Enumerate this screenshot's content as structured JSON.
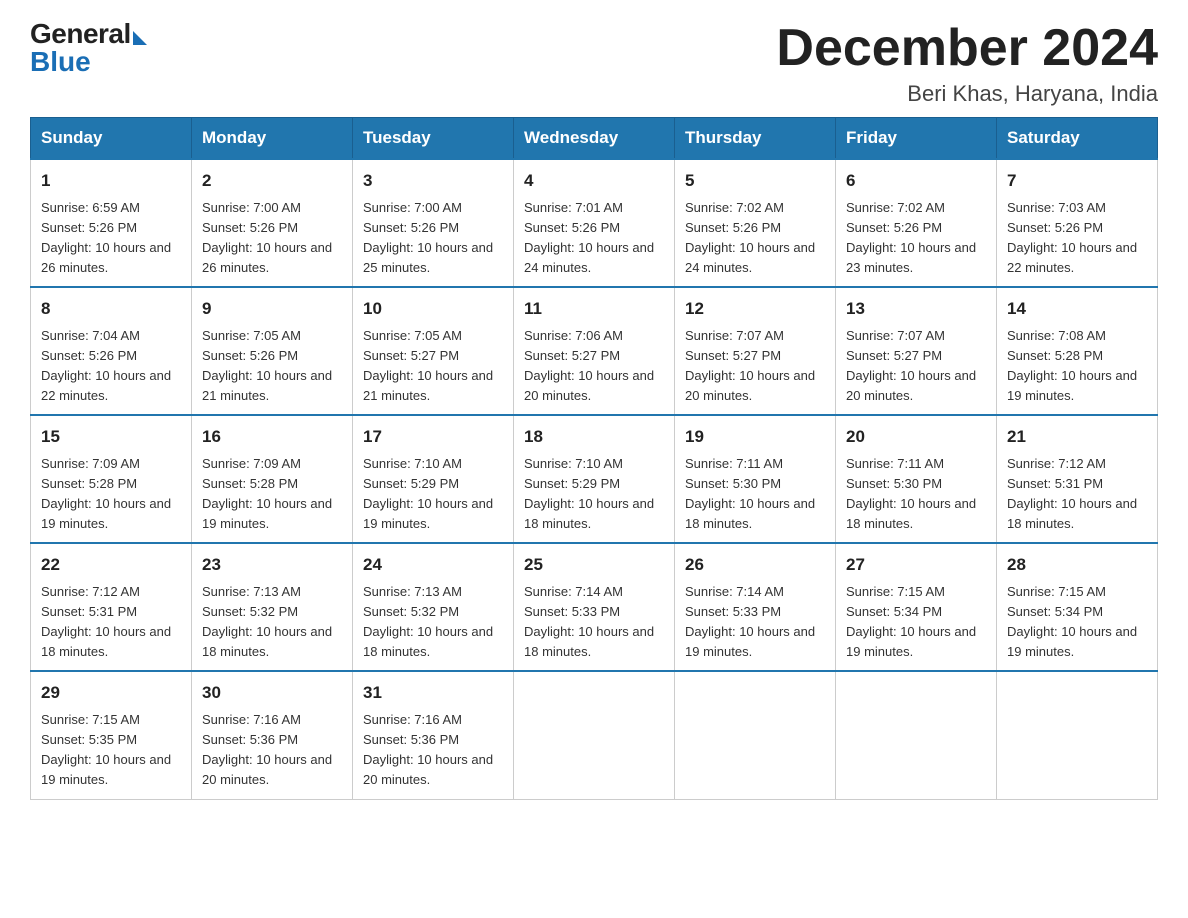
{
  "header": {
    "logo_general": "General",
    "logo_blue": "Blue",
    "main_title": "December 2024",
    "subtitle": "Beri Khas, Haryana, India"
  },
  "days_of_week": [
    "Sunday",
    "Monday",
    "Tuesday",
    "Wednesday",
    "Thursday",
    "Friday",
    "Saturday"
  ],
  "weeks": [
    [
      {
        "day": "1",
        "sunrise": "6:59 AM",
        "sunset": "5:26 PM",
        "daylight": "10 hours and 26 minutes."
      },
      {
        "day": "2",
        "sunrise": "7:00 AM",
        "sunset": "5:26 PM",
        "daylight": "10 hours and 26 minutes."
      },
      {
        "day": "3",
        "sunrise": "7:00 AM",
        "sunset": "5:26 PM",
        "daylight": "10 hours and 25 minutes."
      },
      {
        "day": "4",
        "sunrise": "7:01 AM",
        "sunset": "5:26 PM",
        "daylight": "10 hours and 24 minutes."
      },
      {
        "day": "5",
        "sunrise": "7:02 AM",
        "sunset": "5:26 PM",
        "daylight": "10 hours and 24 minutes."
      },
      {
        "day": "6",
        "sunrise": "7:02 AM",
        "sunset": "5:26 PM",
        "daylight": "10 hours and 23 minutes."
      },
      {
        "day": "7",
        "sunrise": "7:03 AM",
        "sunset": "5:26 PM",
        "daylight": "10 hours and 22 minutes."
      }
    ],
    [
      {
        "day": "8",
        "sunrise": "7:04 AM",
        "sunset": "5:26 PM",
        "daylight": "10 hours and 22 minutes."
      },
      {
        "day": "9",
        "sunrise": "7:05 AM",
        "sunset": "5:26 PM",
        "daylight": "10 hours and 21 minutes."
      },
      {
        "day": "10",
        "sunrise": "7:05 AM",
        "sunset": "5:27 PM",
        "daylight": "10 hours and 21 minutes."
      },
      {
        "day": "11",
        "sunrise": "7:06 AM",
        "sunset": "5:27 PM",
        "daylight": "10 hours and 20 minutes."
      },
      {
        "day": "12",
        "sunrise": "7:07 AM",
        "sunset": "5:27 PM",
        "daylight": "10 hours and 20 minutes."
      },
      {
        "day": "13",
        "sunrise": "7:07 AM",
        "sunset": "5:27 PM",
        "daylight": "10 hours and 20 minutes."
      },
      {
        "day": "14",
        "sunrise": "7:08 AM",
        "sunset": "5:28 PM",
        "daylight": "10 hours and 19 minutes."
      }
    ],
    [
      {
        "day": "15",
        "sunrise": "7:09 AM",
        "sunset": "5:28 PM",
        "daylight": "10 hours and 19 minutes."
      },
      {
        "day": "16",
        "sunrise": "7:09 AM",
        "sunset": "5:28 PM",
        "daylight": "10 hours and 19 minutes."
      },
      {
        "day": "17",
        "sunrise": "7:10 AM",
        "sunset": "5:29 PM",
        "daylight": "10 hours and 19 minutes."
      },
      {
        "day": "18",
        "sunrise": "7:10 AM",
        "sunset": "5:29 PM",
        "daylight": "10 hours and 18 minutes."
      },
      {
        "day": "19",
        "sunrise": "7:11 AM",
        "sunset": "5:30 PM",
        "daylight": "10 hours and 18 minutes."
      },
      {
        "day": "20",
        "sunrise": "7:11 AM",
        "sunset": "5:30 PM",
        "daylight": "10 hours and 18 minutes."
      },
      {
        "day": "21",
        "sunrise": "7:12 AM",
        "sunset": "5:31 PM",
        "daylight": "10 hours and 18 minutes."
      }
    ],
    [
      {
        "day": "22",
        "sunrise": "7:12 AM",
        "sunset": "5:31 PM",
        "daylight": "10 hours and 18 minutes."
      },
      {
        "day": "23",
        "sunrise": "7:13 AM",
        "sunset": "5:32 PM",
        "daylight": "10 hours and 18 minutes."
      },
      {
        "day": "24",
        "sunrise": "7:13 AM",
        "sunset": "5:32 PM",
        "daylight": "10 hours and 18 minutes."
      },
      {
        "day": "25",
        "sunrise": "7:14 AM",
        "sunset": "5:33 PM",
        "daylight": "10 hours and 18 minutes."
      },
      {
        "day": "26",
        "sunrise": "7:14 AM",
        "sunset": "5:33 PM",
        "daylight": "10 hours and 19 minutes."
      },
      {
        "day": "27",
        "sunrise": "7:15 AM",
        "sunset": "5:34 PM",
        "daylight": "10 hours and 19 minutes."
      },
      {
        "day": "28",
        "sunrise": "7:15 AM",
        "sunset": "5:34 PM",
        "daylight": "10 hours and 19 minutes."
      }
    ],
    [
      {
        "day": "29",
        "sunrise": "7:15 AM",
        "sunset": "5:35 PM",
        "daylight": "10 hours and 19 minutes."
      },
      {
        "day": "30",
        "sunrise": "7:16 AM",
        "sunset": "5:36 PM",
        "daylight": "10 hours and 20 minutes."
      },
      {
        "day": "31",
        "sunrise": "7:16 AM",
        "sunset": "5:36 PM",
        "daylight": "10 hours and 20 minutes."
      },
      null,
      null,
      null,
      null
    ]
  ]
}
